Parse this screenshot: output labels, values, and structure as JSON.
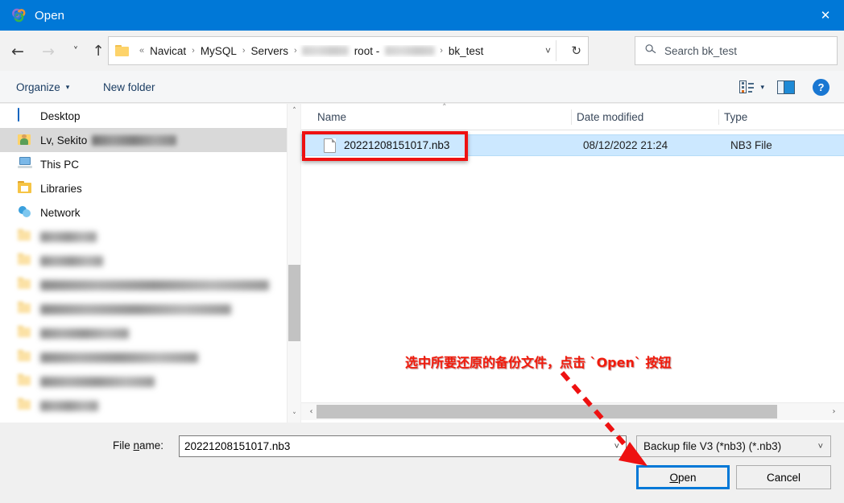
{
  "window": {
    "title": "Open",
    "app_icon": "navicat-logo-icon",
    "close_label": "✕"
  },
  "nav": {
    "back": "←",
    "forward": "→",
    "recent": "˅",
    "up": "↑",
    "refresh": "↻",
    "dropdown": "˅"
  },
  "address": {
    "root_chevrons": "«",
    "crumbs": [
      "Navicat",
      "MySQL",
      "Servers"
    ],
    "redacted_before_root": true,
    "account_crumb": "root -",
    "redacted_after_root": true,
    "final_crumb": "bk_test",
    "separator": "›"
  },
  "search": {
    "icon": "search-icon",
    "placeholder": "Search bk_test"
  },
  "toolbar": {
    "organize": "Organize",
    "organize_caret": "▾",
    "new_folder": "New folder",
    "view_caret": "▾",
    "help": "?"
  },
  "sidebar": {
    "items": [
      {
        "label": "Desktop",
        "icon": "desktop-icon",
        "selected": false,
        "blurred_suffix": 0
      },
      {
        "label": "Lv, Sekito",
        "icon": "user-folder-icon",
        "selected": true,
        "blurred_suffix": 105
      },
      {
        "label": "This PC",
        "icon": "this-pc-icon",
        "selected": false,
        "blurred_suffix": 0
      },
      {
        "label": "Libraries",
        "icon": "libraries-icon",
        "selected": false,
        "blurred_suffix": 0
      },
      {
        "label": "Network",
        "icon": "network-icon",
        "selected": false,
        "blurred_suffix": 0
      },
      {
        "label": "",
        "icon": "folder-icon",
        "selected": false,
        "blurred_suffix": 70
      },
      {
        "label": "",
        "icon": "folder-icon",
        "selected": false,
        "blurred_suffix": 78
      },
      {
        "label": "",
        "icon": "folder-icon",
        "selected": false,
        "blurred_suffix": 284
      },
      {
        "label": "",
        "icon": "folder-icon",
        "selected": false,
        "blurred_suffix": 237
      },
      {
        "label": "",
        "icon": "folder-icon",
        "selected": false,
        "blurred_suffix": 110
      },
      {
        "label": "",
        "icon": "folder-icon",
        "selected": false,
        "blurred_suffix": 196
      },
      {
        "label": "",
        "icon": "folder-icon",
        "selected": false,
        "blurred_suffix": 142
      },
      {
        "label": "",
        "icon": "folder-icon",
        "selected": false,
        "blurred_suffix": 72
      }
    ]
  },
  "file_list": {
    "columns": [
      "Name",
      "Date modified",
      "Type"
    ],
    "sort_indicator": "˄",
    "rows": [
      {
        "name": "20221208151017.nb3",
        "date_modified": "08/12/2022 21:24",
        "type": "NB3 File",
        "selected": true,
        "icon": "file-document-icon"
      }
    ]
  },
  "scroll": {
    "up": "˄",
    "down": "˅",
    "left": "‹",
    "right": "›"
  },
  "footer": {
    "file_name_label_pre": "File ",
    "file_name_label_accel": "n",
    "file_name_label_post": "ame:",
    "file_name_value": "20221208151017.nb3",
    "file_name_caret": "˅",
    "filter_value": "Backup file V3 (*nb3) (*.nb3)",
    "filter_caret": "˅",
    "open_accel": "O",
    "open_rest": "pen",
    "cancel_label": "Cancel"
  },
  "annotations": {
    "callout_text": "选中所要还原的备份文件，点击 `Open` 按钮",
    "highlight_color": "#ee1111",
    "arrow_color": "#ee1111",
    "arrow_style": "dashed-diagonal-down-right"
  }
}
